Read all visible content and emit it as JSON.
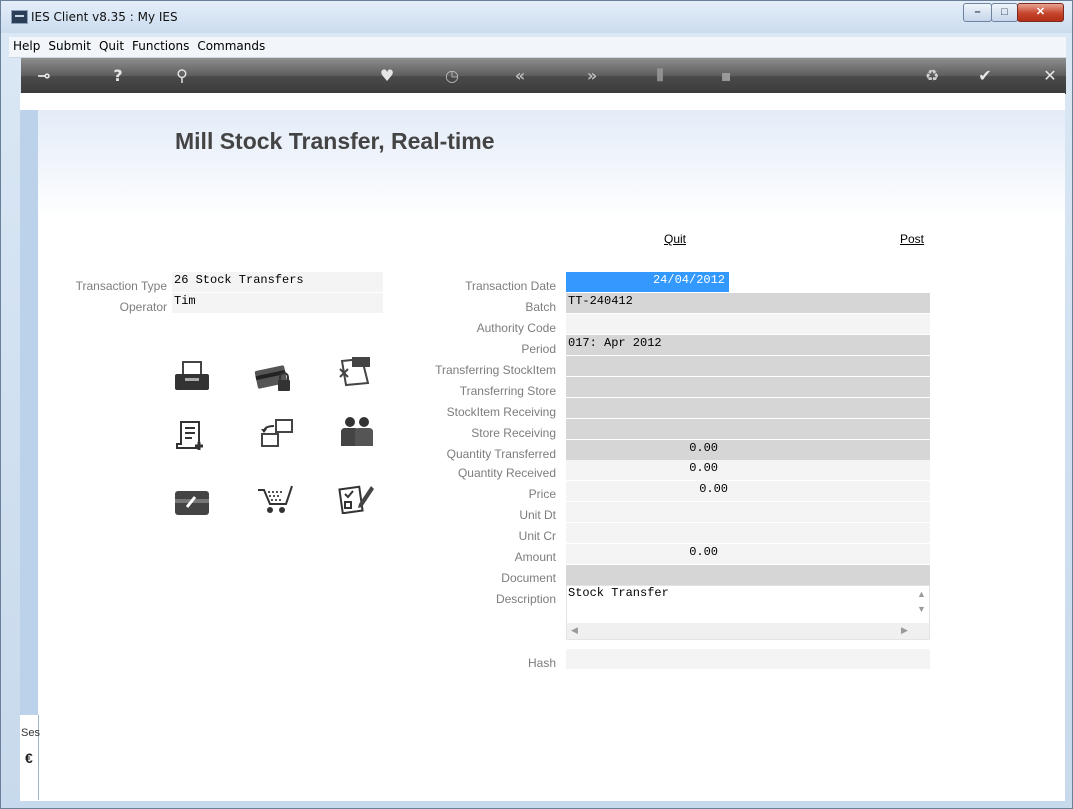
{
  "window": {
    "title": "IES Client v8.35 : My IES"
  },
  "menu": [
    "Help",
    "Submit",
    "Quit",
    "Functions",
    "Commands"
  ],
  "toolbar_icons": [
    "key-icon",
    "help-icon",
    "search-icon",
    "heart-icon",
    "clock-icon",
    "back-icon",
    "forward-icon",
    "tools-icon",
    "cube-icon",
    "recycle-icon",
    "check-icon",
    "close-icon"
  ],
  "page": {
    "title": "Mill Stock Transfer, Real-time"
  },
  "actions": {
    "quit": "Quit",
    "post": "Post"
  },
  "left_fields": {
    "transaction_type_label": "Transaction Type",
    "transaction_type_value": "26 Stock Transfers",
    "operator_label": "Operator",
    "operator_value": "Tim"
  },
  "form": {
    "transaction_date_label": "Transaction Date",
    "transaction_date": "24/04/2012",
    "batch_label": "Batch",
    "batch": "TT-240412",
    "authority_code_label": "Authority Code",
    "authority_code": "",
    "period_label": "Period",
    "period": "017: Apr 2012",
    "transferring_stockitem_label": "Transferring StockItem",
    "transferring_store_label": "Transferring Store",
    "stockitem_receiving_label": "StockItem Receiving",
    "store_receiving_label": "Store Receiving",
    "quantity_transferred_label": "Quantity Transferred",
    "quantity_transferred": "0.00",
    "quantity_received_label": "Quantity Received",
    "quantity_received": "0.00",
    "price_label": "Price",
    "price": "0.00",
    "unit_dt_label": "Unit Dt",
    "unit_cr_label": "Unit Cr",
    "amount_label": "Amount",
    "amount": "0.00",
    "document_label": "Document",
    "description_label": "Description",
    "description": "Stock Transfer",
    "hash_label": "Hash"
  },
  "sidebar": {
    "session_label": "Ses"
  }
}
